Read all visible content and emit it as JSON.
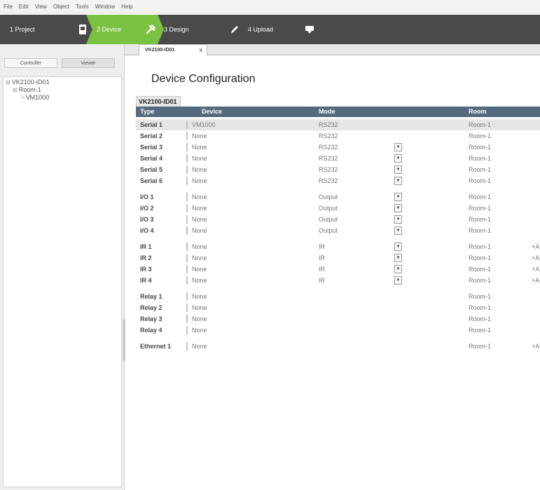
{
  "menu": [
    "File",
    "Edit",
    "View",
    "Object",
    "Tools",
    "Window",
    "Help"
  ],
  "steps": [
    {
      "label": "1 Project",
      "icon": "file-icon"
    },
    {
      "label": "2 Device",
      "icon": "plug-icon"
    },
    {
      "label": "3 Design",
      "icon": "pencil-icon"
    },
    {
      "label": "4 Upload",
      "icon": "download-icon"
    }
  ],
  "left_tabs": [
    "Controller",
    "Viewer"
  ],
  "tree": [
    {
      "label": "VK2100-ID01",
      "glyph": "⊟"
    },
    {
      "label": "Room-1",
      "glyph": "⊟"
    },
    {
      "label": "VM1000",
      "glyph": "└"
    }
  ],
  "doc_tab": {
    "label": "VK2100-ID01",
    "close": "x"
  },
  "heading": "Device Configuration",
  "device_tab": "VK2100-ID01",
  "table": {
    "headers": {
      "type": "Type",
      "device": "Device",
      "mode": "Mode",
      "room": "Room"
    },
    "groups": [
      [
        {
          "type": "Serial 1",
          "device": "VM1000",
          "mode": "RS232",
          "dropdown": false,
          "room": "Room-1",
          "add": "",
          "selected": true
        },
        {
          "type": "Serial 2",
          "device": "None",
          "mode": "RS232",
          "dropdown": false,
          "room": "Room-1",
          "add": ""
        },
        {
          "type": "Serial 3",
          "device": "None",
          "mode": "RS232",
          "dropdown": true,
          "room": "Room-1",
          "add": ""
        },
        {
          "type": "Serial 4",
          "device": "None",
          "mode": "RS232",
          "dropdown": true,
          "room": "Room-1",
          "add": ""
        },
        {
          "type": "Serial 5",
          "device": "None",
          "mode": "RS232",
          "dropdown": true,
          "room": "Room-1",
          "add": ""
        },
        {
          "type": "Serial 6",
          "device": "None",
          "mode": "RS232",
          "dropdown": true,
          "room": "Room-1",
          "add": ""
        }
      ],
      [
        {
          "type": "I/O 1",
          "device": "None",
          "mode": "Output",
          "dropdown": true,
          "room": "Room-1",
          "add": ""
        },
        {
          "type": "I/O 2",
          "device": "None",
          "mode": "Output",
          "dropdown": true,
          "room": "Room-1",
          "add": ""
        },
        {
          "type": "I/O 3",
          "device": "None",
          "mode": "Output",
          "dropdown": true,
          "room": "Room-1",
          "add": ""
        },
        {
          "type": "I/O 4",
          "device": "None",
          "mode": "Output",
          "dropdown": true,
          "room": "Room-1",
          "add": ""
        }
      ],
      [
        {
          "type": "IR 1",
          "device": "None",
          "mode": "IR",
          "dropdown": true,
          "room": "Room-1",
          "add": "+A"
        },
        {
          "type": "IR 2",
          "device": "None",
          "mode": "IR",
          "dropdown": true,
          "room": "Room-1",
          "add": "+A"
        },
        {
          "type": "IR 3",
          "device": "None",
          "mode": "IR",
          "dropdown": true,
          "room": "Room-1",
          "add": "+A"
        },
        {
          "type": "IR 4",
          "device": "None",
          "mode": "IR",
          "dropdown": true,
          "room": "Room-1",
          "add": "+A"
        }
      ],
      [
        {
          "type": "Relay 1",
          "device": "None",
          "mode": "",
          "dropdown": false,
          "room": "Room-1",
          "add": ""
        },
        {
          "type": "Relay 2",
          "device": "None",
          "mode": "",
          "dropdown": false,
          "room": "Room-1",
          "add": ""
        },
        {
          "type": "Relay 3",
          "device": "None",
          "mode": "",
          "dropdown": false,
          "room": "Room-1",
          "add": ""
        },
        {
          "type": "Relay 4",
          "device": "None",
          "mode": "",
          "dropdown": false,
          "room": "Room-1",
          "add": ""
        }
      ],
      [
        {
          "type": "Ethernet 1",
          "device": "None",
          "mode": "",
          "dropdown": false,
          "room": "Room-1",
          "add": "+A"
        }
      ]
    ]
  },
  "colors": {
    "step_active": "#7bc142",
    "step_bar": "#4a4a4a",
    "table_header": "#566a7d",
    "selected_row": "#e6e6e6"
  }
}
